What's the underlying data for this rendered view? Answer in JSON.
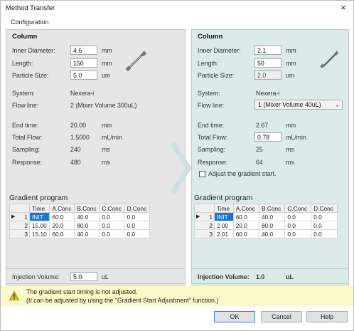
{
  "window": {
    "title": "Method Transfer",
    "close_icon": "×"
  },
  "menu": {
    "configuration": "Configuration"
  },
  "left": {
    "column_header": "Column",
    "inner_diameter_label": "Inner Diameter:",
    "inner_diameter_value": "4.6",
    "inner_diameter_unit": "mm",
    "length_label": "Length:",
    "length_value": "150",
    "length_unit": "mm",
    "particle_size_label": "Particle Size:",
    "particle_size_value": "5.0",
    "particle_size_unit": "um",
    "system_label": "System:",
    "system_value": "Nexera-i",
    "flow_line_label": "Flow line:",
    "flow_line_value": "2 (Mixer Volume 300uL)",
    "end_time_label": "End time:",
    "end_time_value": "20.00",
    "end_time_unit": "min",
    "total_flow_label": "Total Flow:",
    "total_flow_value": "1.5000",
    "total_flow_unit": "mL/min",
    "sampling_label": "Sampling:",
    "sampling_value": "240",
    "sampling_unit": "ms",
    "response_label": "Response:",
    "response_value": "480",
    "response_unit": "ms",
    "gradient_title": "Gradient program",
    "columns": [
      "Time",
      "A.Conc",
      "B.Conc",
      "C.Conc",
      "D.Conc"
    ],
    "rows": [
      {
        "n": "1",
        "cells": [
          "INIT",
          "60.0",
          "40.0",
          "0.0",
          "0.0"
        ]
      },
      {
        "n": "2",
        "cells": [
          "15.00",
          "20.0",
          "80.0",
          "0.0",
          "0.0"
        ]
      },
      {
        "n": "3",
        "cells": [
          "15.10",
          "60.0",
          "40.0",
          "0.0",
          "0.0"
        ]
      }
    ],
    "injection_label": "Injection Volume:",
    "injection_value": "5.0",
    "injection_unit": "uL"
  },
  "right": {
    "column_header": "Column",
    "inner_diameter_label": "Inner Diameter:",
    "inner_diameter_value": "2.1",
    "inner_diameter_unit": "mm",
    "length_label": "Length:",
    "length_value": "50",
    "length_unit": "mm",
    "particle_size_label": "Particle Size:",
    "particle_size_value": "2.0",
    "particle_size_unit": "um",
    "system_label": "System:",
    "system_value": "Nexera-i",
    "flow_line_label": "Flow line:",
    "flow_line_value": "1 (Mixer Volume 40uL)",
    "end_time_label": "End time:",
    "end_time_value": "2.67",
    "end_time_unit": "min",
    "total_flow_label": "Total Flow:",
    "total_flow_value": "0.78",
    "total_flow_unit": "mL/min",
    "sampling_label": "Sampling:",
    "sampling_value": "25",
    "sampling_unit": "ms",
    "response_label": "Response:",
    "response_value": "64",
    "response_unit": "ms",
    "adjust_label": "Adjust the gradient start.",
    "adjust_checked": false,
    "gradient_title": "Gradient program",
    "columns": [
      "Time",
      "A.Conc",
      "B.Conc",
      "C.Conc",
      "D.Conc"
    ],
    "rows": [
      {
        "n": "1",
        "cells": [
          "INIT",
          "60.0",
          "40.0",
          "0.0",
          "0.0"
        ]
      },
      {
        "n": "2",
        "cells": [
          "2.00",
          "20.0",
          "80.0",
          "0.0",
          "0.0"
        ]
      },
      {
        "n": "3",
        "cells": [
          "2.01",
          "60.0",
          "40.0",
          "0.0",
          "0.0"
        ]
      }
    ],
    "injection_label": "Injection Volume:",
    "injection_value": "1.0",
    "injection_unit": "uL"
  },
  "warning": {
    "line1": "The gradient start timing is not adjusted.",
    "line2": "(It can be adjusted by using the \"Gradient Start Adjustment\" function.)",
    "icon": "warning-triangle-icon"
  },
  "buttons": {
    "ok": "OK",
    "cancel": "Cancel",
    "help": "Help"
  },
  "colors": {
    "left_panel": "#e6e6e6",
    "right_panel": "#dceaea",
    "selection": "#1e73d8",
    "warning_bg": "#fcf9c8"
  }
}
